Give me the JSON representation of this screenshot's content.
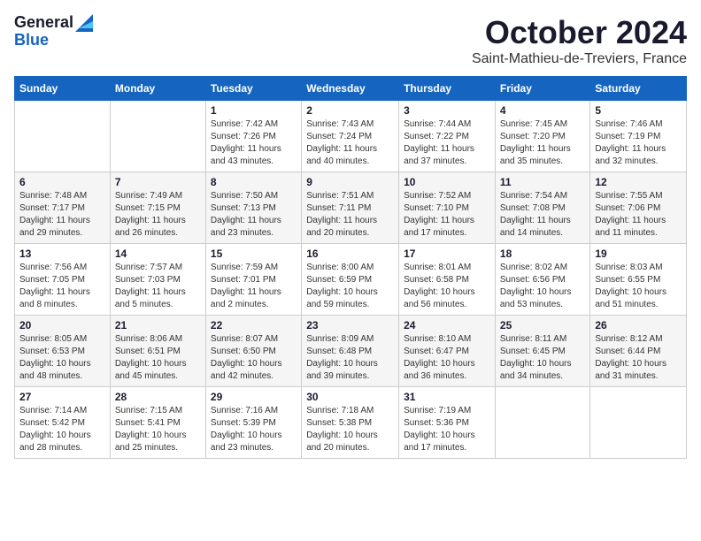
{
  "logo": {
    "line1": "General",
    "line2": "Blue"
  },
  "title": "October 2024",
  "location": "Saint-Mathieu-de-Treviers, France",
  "days_of_week": [
    "Sunday",
    "Monday",
    "Tuesday",
    "Wednesday",
    "Thursday",
    "Friday",
    "Saturday"
  ],
  "weeks": [
    [
      {
        "day": "",
        "sunrise": "",
        "sunset": "",
        "daylight": ""
      },
      {
        "day": "",
        "sunrise": "",
        "sunset": "",
        "daylight": ""
      },
      {
        "day": "1",
        "sunrise": "Sunrise: 7:42 AM",
        "sunset": "Sunset: 7:26 PM",
        "daylight": "Daylight: 11 hours and 43 minutes."
      },
      {
        "day": "2",
        "sunrise": "Sunrise: 7:43 AM",
        "sunset": "Sunset: 7:24 PM",
        "daylight": "Daylight: 11 hours and 40 minutes."
      },
      {
        "day": "3",
        "sunrise": "Sunrise: 7:44 AM",
        "sunset": "Sunset: 7:22 PM",
        "daylight": "Daylight: 11 hours and 37 minutes."
      },
      {
        "day": "4",
        "sunrise": "Sunrise: 7:45 AM",
        "sunset": "Sunset: 7:20 PM",
        "daylight": "Daylight: 11 hours and 35 minutes."
      },
      {
        "day": "5",
        "sunrise": "Sunrise: 7:46 AM",
        "sunset": "Sunset: 7:19 PM",
        "daylight": "Daylight: 11 hours and 32 minutes."
      }
    ],
    [
      {
        "day": "6",
        "sunrise": "Sunrise: 7:48 AM",
        "sunset": "Sunset: 7:17 PM",
        "daylight": "Daylight: 11 hours and 29 minutes."
      },
      {
        "day": "7",
        "sunrise": "Sunrise: 7:49 AM",
        "sunset": "Sunset: 7:15 PM",
        "daylight": "Daylight: 11 hours and 26 minutes."
      },
      {
        "day": "8",
        "sunrise": "Sunrise: 7:50 AM",
        "sunset": "Sunset: 7:13 PM",
        "daylight": "Daylight: 11 hours and 23 minutes."
      },
      {
        "day": "9",
        "sunrise": "Sunrise: 7:51 AM",
        "sunset": "Sunset: 7:11 PM",
        "daylight": "Daylight: 11 hours and 20 minutes."
      },
      {
        "day": "10",
        "sunrise": "Sunrise: 7:52 AM",
        "sunset": "Sunset: 7:10 PM",
        "daylight": "Daylight: 11 hours and 17 minutes."
      },
      {
        "day": "11",
        "sunrise": "Sunrise: 7:54 AM",
        "sunset": "Sunset: 7:08 PM",
        "daylight": "Daylight: 11 hours and 14 minutes."
      },
      {
        "day": "12",
        "sunrise": "Sunrise: 7:55 AM",
        "sunset": "Sunset: 7:06 PM",
        "daylight": "Daylight: 11 hours and 11 minutes."
      }
    ],
    [
      {
        "day": "13",
        "sunrise": "Sunrise: 7:56 AM",
        "sunset": "Sunset: 7:05 PM",
        "daylight": "Daylight: 11 hours and 8 minutes."
      },
      {
        "day": "14",
        "sunrise": "Sunrise: 7:57 AM",
        "sunset": "Sunset: 7:03 PM",
        "daylight": "Daylight: 11 hours and 5 minutes."
      },
      {
        "day": "15",
        "sunrise": "Sunrise: 7:59 AM",
        "sunset": "Sunset: 7:01 PM",
        "daylight": "Daylight: 11 hours and 2 minutes."
      },
      {
        "day": "16",
        "sunrise": "Sunrise: 8:00 AM",
        "sunset": "Sunset: 6:59 PM",
        "daylight": "Daylight: 10 hours and 59 minutes."
      },
      {
        "day": "17",
        "sunrise": "Sunrise: 8:01 AM",
        "sunset": "Sunset: 6:58 PM",
        "daylight": "Daylight: 10 hours and 56 minutes."
      },
      {
        "day": "18",
        "sunrise": "Sunrise: 8:02 AM",
        "sunset": "Sunset: 6:56 PM",
        "daylight": "Daylight: 10 hours and 53 minutes."
      },
      {
        "day": "19",
        "sunrise": "Sunrise: 8:03 AM",
        "sunset": "Sunset: 6:55 PM",
        "daylight": "Daylight: 10 hours and 51 minutes."
      }
    ],
    [
      {
        "day": "20",
        "sunrise": "Sunrise: 8:05 AM",
        "sunset": "Sunset: 6:53 PM",
        "daylight": "Daylight: 10 hours and 48 minutes."
      },
      {
        "day": "21",
        "sunrise": "Sunrise: 8:06 AM",
        "sunset": "Sunset: 6:51 PM",
        "daylight": "Daylight: 10 hours and 45 minutes."
      },
      {
        "day": "22",
        "sunrise": "Sunrise: 8:07 AM",
        "sunset": "Sunset: 6:50 PM",
        "daylight": "Daylight: 10 hours and 42 minutes."
      },
      {
        "day": "23",
        "sunrise": "Sunrise: 8:09 AM",
        "sunset": "Sunset: 6:48 PM",
        "daylight": "Daylight: 10 hours and 39 minutes."
      },
      {
        "day": "24",
        "sunrise": "Sunrise: 8:10 AM",
        "sunset": "Sunset: 6:47 PM",
        "daylight": "Daylight: 10 hours and 36 minutes."
      },
      {
        "day": "25",
        "sunrise": "Sunrise: 8:11 AM",
        "sunset": "Sunset: 6:45 PM",
        "daylight": "Daylight: 10 hours and 34 minutes."
      },
      {
        "day": "26",
        "sunrise": "Sunrise: 8:12 AM",
        "sunset": "Sunset: 6:44 PM",
        "daylight": "Daylight: 10 hours and 31 minutes."
      }
    ],
    [
      {
        "day": "27",
        "sunrise": "Sunrise: 7:14 AM",
        "sunset": "Sunset: 5:42 PM",
        "daylight": "Daylight: 10 hours and 28 minutes."
      },
      {
        "day": "28",
        "sunrise": "Sunrise: 7:15 AM",
        "sunset": "Sunset: 5:41 PM",
        "daylight": "Daylight: 10 hours and 25 minutes."
      },
      {
        "day": "29",
        "sunrise": "Sunrise: 7:16 AM",
        "sunset": "Sunset: 5:39 PM",
        "daylight": "Daylight: 10 hours and 23 minutes."
      },
      {
        "day": "30",
        "sunrise": "Sunrise: 7:18 AM",
        "sunset": "Sunset: 5:38 PM",
        "daylight": "Daylight: 10 hours and 20 minutes."
      },
      {
        "day": "31",
        "sunrise": "Sunrise: 7:19 AM",
        "sunset": "Sunset: 5:36 PM",
        "daylight": "Daylight: 10 hours and 17 minutes."
      },
      {
        "day": "",
        "sunrise": "",
        "sunset": "",
        "daylight": ""
      },
      {
        "day": "",
        "sunrise": "",
        "sunset": "",
        "daylight": ""
      }
    ]
  ]
}
